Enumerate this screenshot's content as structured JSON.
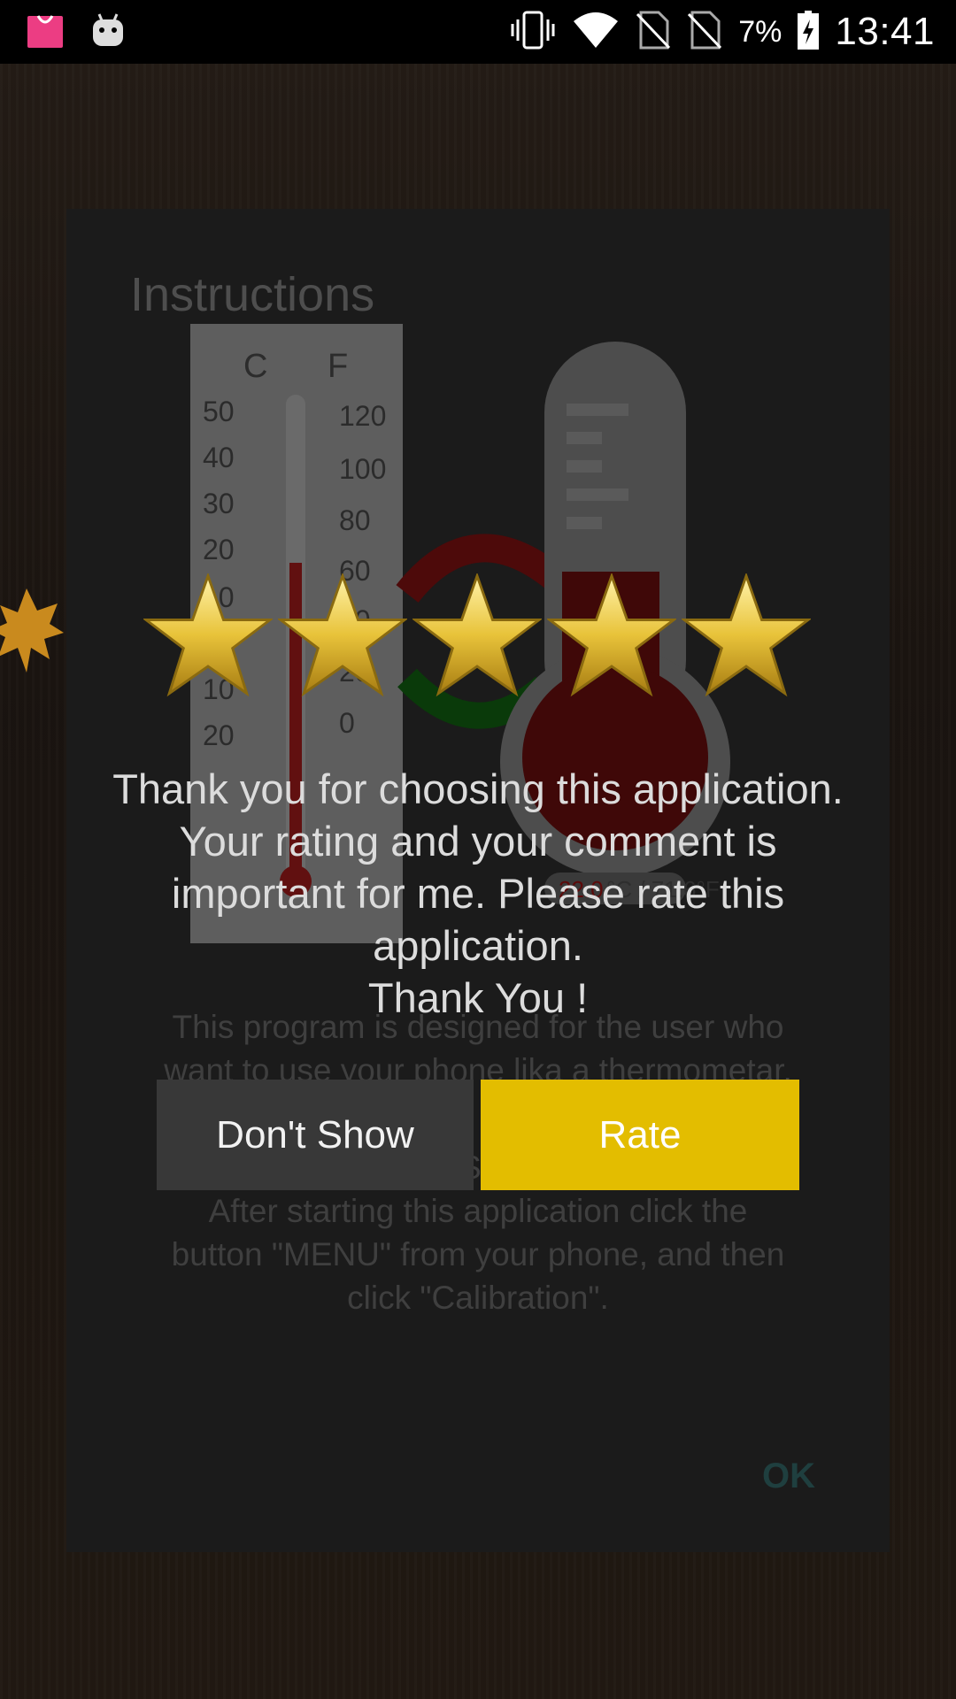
{
  "status_bar": {
    "battery_percent": "7%",
    "time": "13:41",
    "icons": [
      "shopping-bag-icon",
      "android-icon",
      "vibrate-icon",
      "wifi-icon",
      "no-sim-icon",
      "no-sim-icon",
      "battery-charging-icon"
    ]
  },
  "instructions_dialog": {
    "title": "Instructions",
    "image": {
      "scale_c": "C",
      "scale_f": "F",
      "c_ticks": [
        "50",
        "40",
        "30",
        "20",
        "10",
        "0",
        "10",
        "20"
      ],
      "f_ticks": [
        "120",
        "100",
        "80",
        "60",
        "40",
        "20",
        "0"
      ],
      "readout_c": "22.0",
      "readout_rest": "°C / 71.6°F"
    },
    "text_lines": [
      "This program is designed for the user who",
      "want to use your phone lika a thermometar,",
      "w                                        e",
      "PLEASE READ THIS BEFORE USING IT!",
      "After starting this application click the",
      "button \"MENU\" from your phone, and then",
      "click \"Calibration\"."
    ],
    "ok_label": "OK"
  },
  "rating_dialog": {
    "stars_count": 5,
    "message_lines": [
      "Thank you for choosing this application.",
      "Your rating and your comment is",
      "important for me. Please rate this",
      "application.",
      "Thank You !"
    ],
    "dont_show_label": "Don't Show",
    "rate_label": "Rate"
  },
  "colors": {
    "rate_button": "#e3bd00",
    "dont_show_button": "#383838",
    "star_fill": "#e8c33a"
  }
}
